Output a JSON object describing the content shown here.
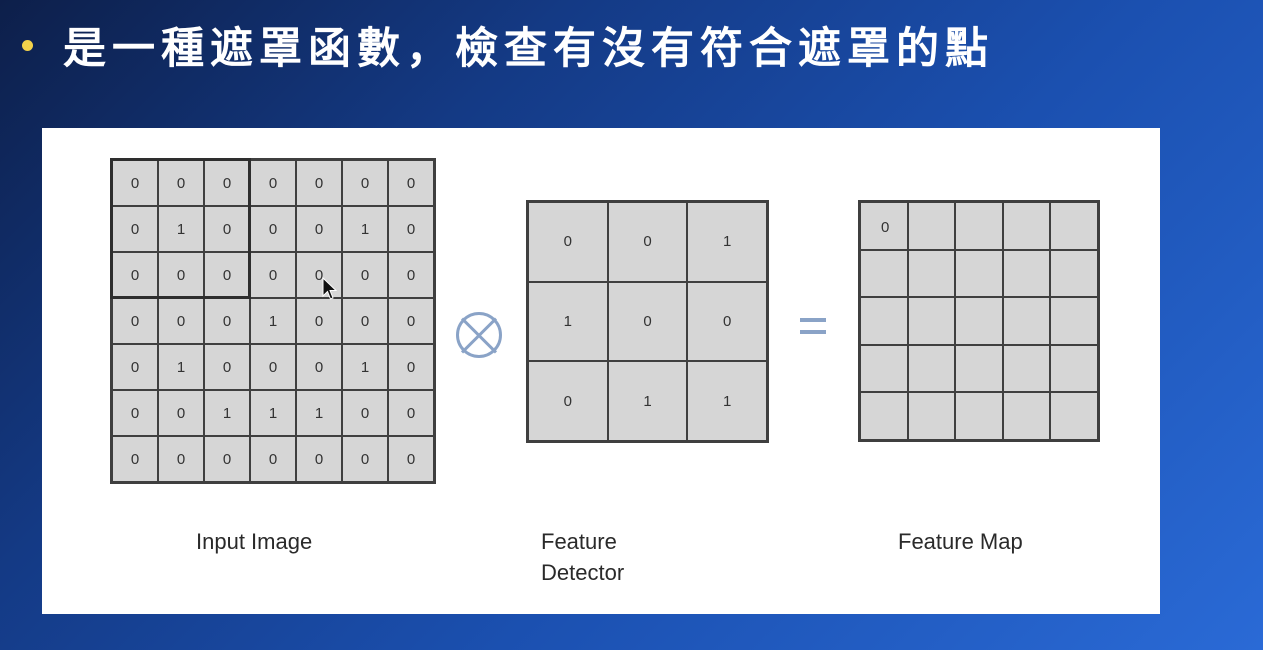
{
  "slide": {
    "title": "是一種遮罩函數，檢查有沒有符合遮罩的點"
  },
  "input_image": {
    "caption": "Input Image",
    "matrix": [
      [
        0,
        0,
        0,
        0,
        0,
        0,
        0
      ],
      [
        0,
        1,
        0,
        0,
        0,
        1,
        0
      ],
      [
        0,
        0,
        0,
        0,
        0,
        0,
        0
      ],
      [
        0,
        0,
        0,
        1,
        0,
        0,
        0
      ],
      [
        0,
        1,
        0,
        0,
        0,
        1,
        0
      ],
      [
        0,
        0,
        1,
        1,
        1,
        0,
        0
      ],
      [
        0,
        0,
        0,
        0,
        0,
        0,
        0
      ]
    ]
  },
  "feature_detector": {
    "caption_line1": "Feature",
    "caption_line2": "Detector",
    "matrix": [
      [
        0,
        0,
        1
      ],
      [
        1,
        0,
        0
      ],
      [
        0,
        1,
        1
      ]
    ]
  },
  "feature_map": {
    "caption": "Feature Map",
    "matrix": [
      [
        "0",
        "",
        "",
        "",
        ""
      ],
      [
        "",
        "",
        "",
        "",
        ""
      ],
      [
        "",
        "",
        "",
        "",
        ""
      ],
      [
        "",
        "",
        "",
        "",
        ""
      ],
      [
        "",
        "",
        "",
        "",
        ""
      ]
    ]
  },
  "operators": {
    "convolution": "convolution-operator-icon",
    "equals": "equals-icon"
  },
  "colors": {
    "bullet": "#f2d24b",
    "cell_fill": "#d6d6d6",
    "operator": "#8aa3c7"
  }
}
